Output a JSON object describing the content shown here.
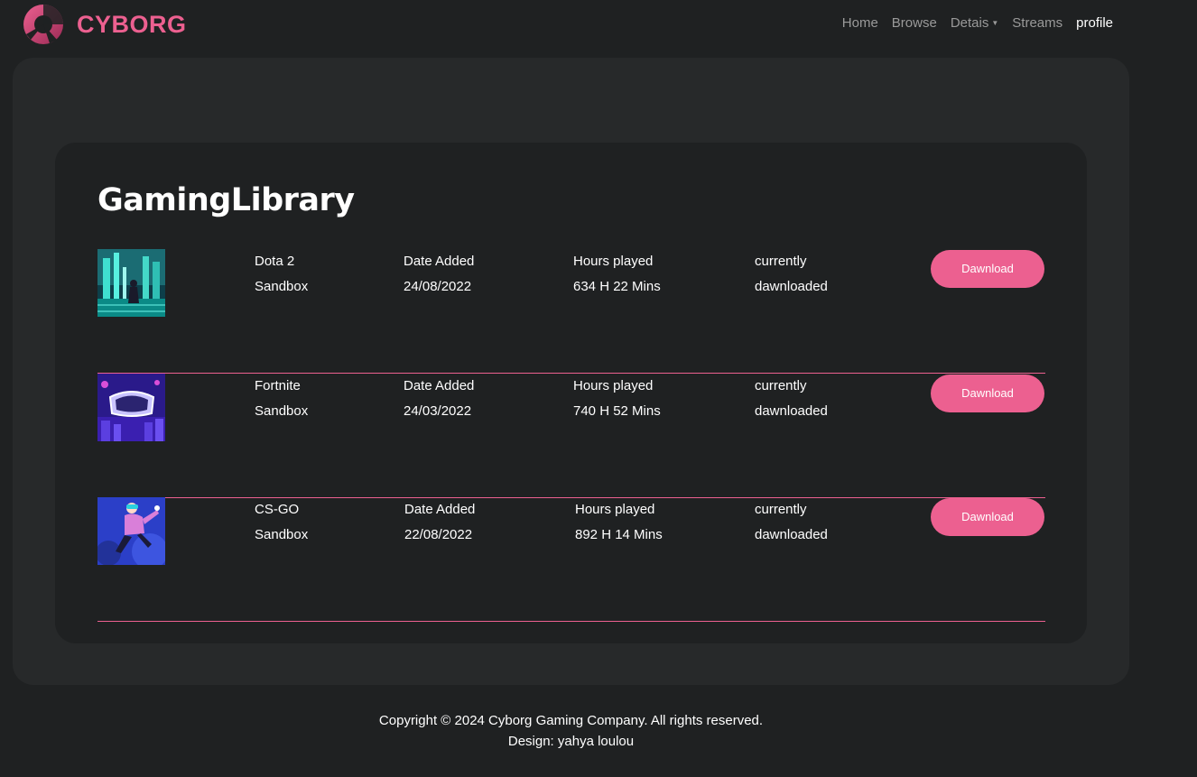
{
  "brand": {
    "name": "CYBORG"
  },
  "nav": {
    "items": [
      {
        "label": "Home",
        "active": false,
        "dropdown": false
      },
      {
        "label": "Browse",
        "active": false,
        "dropdown": false
      },
      {
        "label": "Detais",
        "active": false,
        "dropdown": true
      },
      {
        "label": "Streams",
        "active": false,
        "dropdown": false
      },
      {
        "label": "profile",
        "active": true,
        "dropdown": false
      }
    ]
  },
  "library": {
    "title": "GamingLibrary",
    "games": [
      {
        "name": "Dota 2",
        "genre": "Sandbox",
        "date_label": "Date Added",
        "date": "24/08/2022",
        "hours_label": "Hours played",
        "hours": "634 H 22 Mins",
        "status_line1": "currently",
        "status_line2": "dawnloaded",
        "button": "Dawnload"
      },
      {
        "name": "Fortnite",
        "genre": "Sandbox",
        "date_label": "Date Added",
        "date": "24/03/2022",
        "hours_label": "Hours played",
        "hours": "740 H 52 Mins",
        "status_line1": "currently",
        "status_line2": "dawnloaded",
        "button": "Dawnload"
      },
      {
        "name": "CS-GO",
        "genre": "Sandbox",
        "date_label": "Date Added",
        "date": "22/08/2022",
        "hours_label": "Hours played",
        "hours": "892 H 14 Mins",
        "status_line1": "currently",
        "status_line2": "dawnloaded",
        "button": "Dawnload"
      }
    ]
  },
  "footer": {
    "copyright": "Copyright © 2024 Cyborg Gaming Company. All rights reserved.",
    "design": "Design: yahya loulou"
  },
  "colors": {
    "accent": "#ec6090",
    "background": "#1f2122",
    "panel": "#27292a"
  }
}
